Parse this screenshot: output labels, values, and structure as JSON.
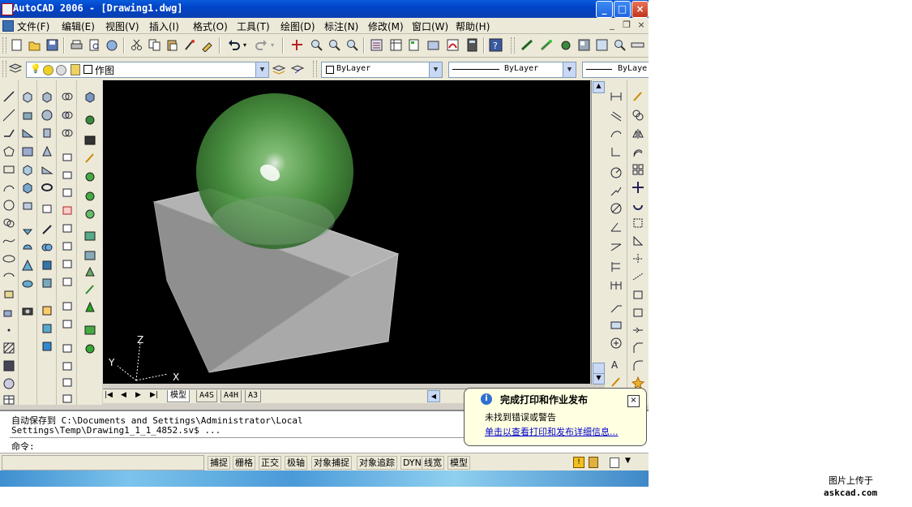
{
  "window": {
    "title": "AutoCAD 2006 - [Drawing1.dwg]"
  },
  "menu": [
    {
      "label": "文件(F)"
    },
    {
      "label": "编辑(E)"
    },
    {
      "label": "视图(V)"
    },
    {
      "label": "插入(I)"
    },
    {
      "label": "格式(O)"
    },
    {
      "label": "工具(T)"
    },
    {
      "label": "绘图(D)"
    },
    {
      "label": "标注(N)"
    },
    {
      "label": "修改(M)"
    },
    {
      "label": "窗口(W)"
    },
    {
      "label": "帮助(H)"
    }
  ],
  "layers": {
    "current_layer": "作图"
  },
  "properties": {
    "color": "ByLayer",
    "linetype": "ByLayer",
    "lineweight": "ByLaye"
  },
  "ucs": {
    "x": "X",
    "y": "Y",
    "z": "Z"
  },
  "tabs": [
    {
      "label": "模型"
    },
    {
      "label": "A4S"
    },
    {
      "label": "A4H"
    },
    {
      "label": "A3"
    }
  ],
  "command": {
    "line1": "自动保存到 C:\\Documents and Settings\\Administrator\\Local",
    "line2": "Settings\\Temp\\Drawing1_1_1_4852.sv$ ...",
    "prompt": "命令:"
  },
  "status": [
    {
      "label": "捕捉"
    },
    {
      "label": "栅格"
    },
    {
      "label": "正交"
    },
    {
      "label": "极轴"
    },
    {
      "label": "对象捕捉"
    },
    {
      "label": "对象追踪"
    },
    {
      "label": "DYN"
    },
    {
      "label": "线宽"
    },
    {
      "label": "模型"
    }
  ],
  "balloon": {
    "title": "完成打印和作业发布",
    "message": "未找到错误或警告",
    "link": "单击以查看打印和发布详细信息..."
  },
  "watermark": {
    "line1": "图片上传于",
    "line2": "askcad.com"
  },
  "colors": {
    "titlebar": "#0a5bdc",
    "viewport": "#000000",
    "sphere": "#4f9a45",
    "box": "#a8a8a8",
    "link": "#0000cc"
  }
}
